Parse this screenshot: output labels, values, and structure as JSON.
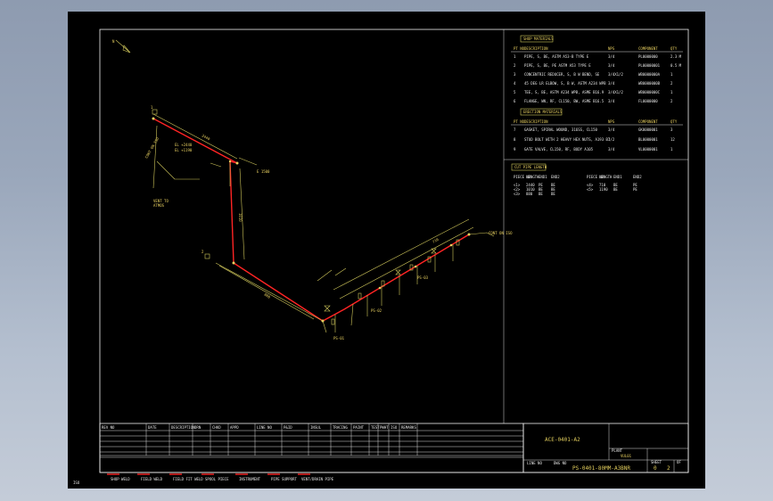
{
  "drawing": {
    "north_mark": "N",
    "bom": {
      "title": "SHOP MATERIALS",
      "columns": [
        "PT NO",
        "DESCRIPTION",
        "NPS",
        "COMPONENT",
        "QTY"
      ],
      "rows": [
        [
          "1",
          "PIPE, S, BE, ASTM A53-B TYPE E",
          "3/4",
          "PL0000000",
          "2.3 M"
        ],
        [
          "2",
          "PIPE, S, BE, PE ASTM A53 TYPE E",
          "3/4",
          "PL00000001",
          "0.5 M"
        ],
        [
          "3",
          "CONCENTRIC REDUCER, S, B W BEND, SE",
          "3/4X1/2",
          "WB0000000A",
          "1"
        ],
        [
          "4",
          "45 DEG LR ELBOW, S, B W, ASTM A234 WPB",
          "3/4",
          "WB0000000B",
          "2"
        ],
        [
          "5",
          "TEE, S, BE, ASTM A234 WPB, ASME B16.9",
          "3/4X1/2",
          "WB0000000C",
          "1"
        ],
        [
          "6",
          "FLANGE, WN, RF, CL150, BW, ASME B16.5",
          "3/4",
          "FL0000000",
          "2"
        ]
      ]
    },
    "erection": {
      "title": "ERECTION MATERIALS",
      "columns": [
        "PT NO",
        "DESCRIPTION",
        "NPS",
        "COMPONENT",
        "QTY"
      ],
      "rows": [
        [
          "7",
          "GASKET, SPIRAL WOUND, 316SS, CL150",
          "3/4",
          "GK0000001",
          "3"
        ],
        [
          "8",
          "STUD BOLT WITH 2 HEAVY HEX NUTS, A193 B7",
          "1/2",
          "BL0000001",
          "12"
        ],
        [
          "9",
          "GATE VALVE, CL150, RF, BODY A105",
          "3/4",
          "VL0000001",
          "1"
        ]
      ]
    },
    "cut_list": {
      "title": "CUT PIPE LENGTH",
      "columns": [
        "PIECE NO",
        "LENGTH",
        "END1",
        "END2",
        "PIECE NO",
        "LENGTH",
        "END1",
        "END2"
      ],
      "rows": [
        [
          "<1>",
          "2440",
          "PE",
          "BE",
          "<4>",
          "710",
          "BE",
          "PE"
        ],
        [
          "<2>",
          "1010",
          "BE",
          "BE",
          "<5>",
          "1190",
          "BE",
          "PE"
        ],
        [
          "<3>",
          "880",
          "BE",
          "BE",
          "",
          "",
          "",
          ""
        ]
      ]
    },
    "revision_headers": [
      "REV NO",
      "DATE",
      "DESCRIPTION",
      "DRN",
      "CHKD",
      "APPD",
      "LINE NO",
      "P&ID",
      "INSUL",
      "TRACING",
      "PAINT",
      "TEST",
      "PWHT",
      "ISO",
      "REMARKS"
    ],
    "title_block": {
      "drawing_no": "ACE-0401-A2",
      "client": "VUL01",
      "line_no": "PS-0401-80MM-A3BNR",
      "sheet": "0",
      "of": "2",
      "label_sheet": "SHEET",
      "label_of": "OF",
      "label_drawing": "DWG NO",
      "label_line": "LINE NO",
      "label_plant": "PLANT"
    },
    "legend": [
      "SHOP WELD",
      "FIELD WELD",
      "FIELD FIT WELD",
      "SPOOL PIECE",
      "INSTRUMENT",
      "PIPE SUPPORT",
      "VENT/DRAIN PIPE"
    ],
    "iso_labels": {
      "top_tag": "1",
      "valve_tag": "2",
      "start_note": "CONT ON ISO",
      "end_note": "CONT ON ISO",
      "elev1": "EL +2440",
      "elev2": "EL +1190",
      "dim_a": "2440",
      "dim_b": "1010",
      "dim_c": "880",
      "dim_d": "710",
      "left_note_1": "VENT TO",
      "left_note_2": "ATMOS",
      "support_1": "PS-01",
      "support_2": "PS-02",
      "support_3": "PS-03",
      "coord": "E 1500"
    },
    "corner_text": "ISO"
  },
  "colors": {
    "pipe": "#ff2424",
    "annotation": "#e8d060",
    "frame": "#f0f0f0"
  }
}
